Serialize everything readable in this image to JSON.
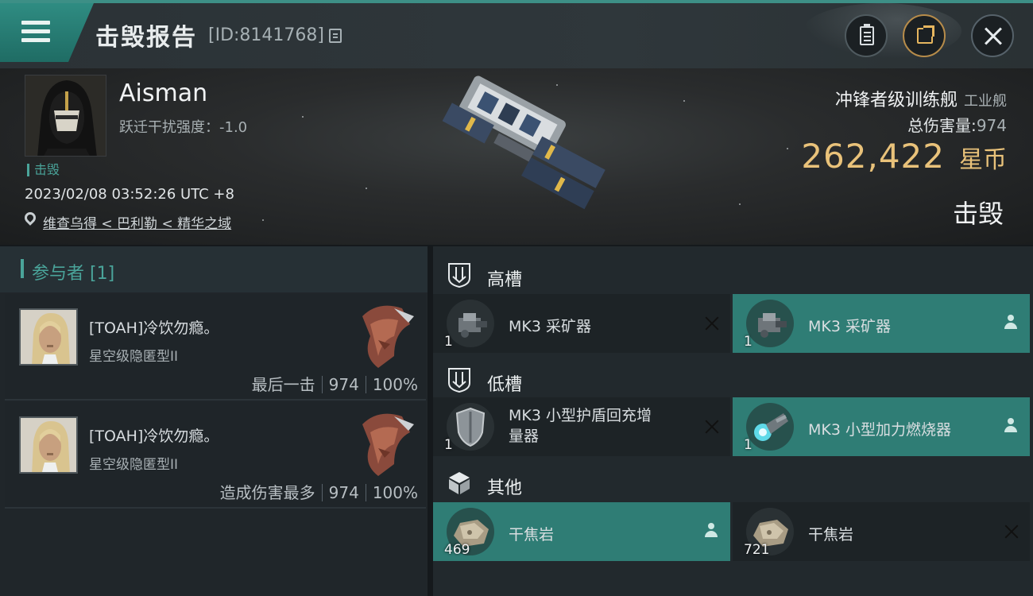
{
  "header": {
    "title": "击毁报告",
    "report_id": "[ID:8141768]"
  },
  "victim": {
    "pilot_name": "Aisman",
    "warp_jam": "跃迁干扰强度：-1.0",
    "tag": "击毁",
    "datetime": "2023/02/08 03:52:26 UTC +8",
    "location": "维查乌得 < 巴利勒 < 精华之域",
    "ship_name": "冲锋者级训练舰",
    "ship_class": "工业舰",
    "total_damage_label": "总伤害量:",
    "total_damage": "974",
    "isk_value": "262,422",
    "isk_unit": "星币",
    "result": "击毁"
  },
  "participants": {
    "label": "参与者 [1]",
    "attackers": [
      {
        "name": "[TOAH]冷饮勿瘾。",
        "ship": "星空级隐匿型II",
        "role": "最后一击",
        "damage": "974",
        "percent": "100%"
      },
      {
        "name": "[TOAH]冷饮勿瘾。",
        "ship": "星空级隐匿型II",
        "role": "造成伤害最多",
        "damage": "974",
        "percent": "100%"
      }
    ]
  },
  "fittings": {
    "high": {
      "label": "高槽",
      "items": [
        {
          "name": "MK3 采矿器",
          "qty": "1",
          "state": "destroyed"
        },
        {
          "name": "MK3 采矿器",
          "qty": "1",
          "state": "dropped"
        }
      ]
    },
    "low": {
      "label": "低槽",
      "items": [
        {
          "name": "MK3 小型护盾回充增量器",
          "name_line1": "MK3 小型护盾回充增",
          "name_line2": "量器",
          "qty": "1",
          "state": "destroyed"
        },
        {
          "name": "MK3 小型加力燃烧器",
          "qty": "1",
          "state": "dropped"
        }
      ]
    },
    "other": {
      "label": "其他",
      "items": [
        {
          "name": "干焦岩",
          "qty": "469",
          "state": "dropped"
        },
        {
          "name": "干焦岩",
          "qty": "721",
          "state": "destroyed"
        }
      ]
    }
  },
  "colors": {
    "accent_teal": "#2f7d75",
    "isk_gold": "#e9c27a",
    "panel_dark": "#1d2326"
  },
  "icons": [
    "menu-icon",
    "copy-icon",
    "clipboard-icon",
    "share-icon",
    "close-icon",
    "location-pin-icon",
    "high-slot-icon",
    "low-slot-icon",
    "cargo-box-icon",
    "destroyed-x-icon",
    "dropped-person-icon"
  ]
}
